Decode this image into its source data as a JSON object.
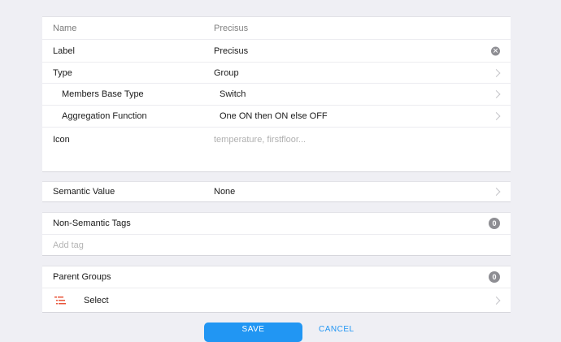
{
  "form": {
    "name": {
      "label": "Name",
      "value": "Precisus"
    },
    "label": {
      "label": "Label",
      "value": "Precisus"
    },
    "type": {
      "label": "Type",
      "value": "Group"
    },
    "members_base_type": {
      "label": "Members Base Type",
      "value": "Switch"
    },
    "aggregation_function": {
      "label": "Aggregation Function",
      "value": "One ON then ON else OFF"
    },
    "icon": {
      "label": "Icon",
      "placeholder": "temperature, firstfloor..."
    }
  },
  "semantic": {
    "label": "Semantic Value",
    "value": "None"
  },
  "tags": {
    "label": "Non-Semantic Tags",
    "count": "0",
    "add_placeholder": "Add tag"
  },
  "parent_groups": {
    "label": "Parent Groups",
    "count": "0",
    "select_label": "Select"
  },
  "actions": {
    "save": "SAVE",
    "cancel": "CANCEL"
  },
  "icons": {
    "clear": "clear-circle-icon",
    "chevron": "chevron-right-icon",
    "list": "list-icon"
  },
  "colors": {
    "accent": "#2196f3",
    "list_icon": "#e8553a",
    "badge": "#8e8e93",
    "background": "#efeff4"
  }
}
